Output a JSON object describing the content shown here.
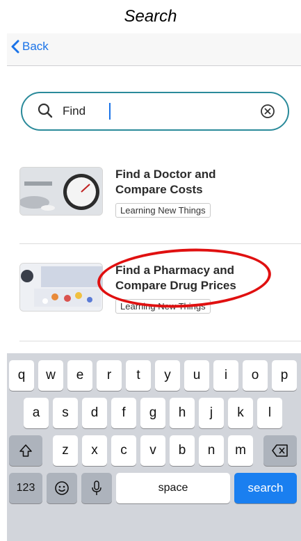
{
  "caption": "Search",
  "nav": {
    "back_label": "Back"
  },
  "search": {
    "value": "Find"
  },
  "results": [
    {
      "title_line1": "Find a Doctor and",
      "title_line2": "Compare Costs",
      "tag": "Learning New Things"
    },
    {
      "title_line1": "Find a Pharmacy and",
      "title_line2": "Compare Drug Prices",
      "tag": "Learning New Things"
    }
  ],
  "keyboard": {
    "row1": [
      "q",
      "w",
      "e",
      "r",
      "t",
      "y",
      "u",
      "i",
      "o",
      "p"
    ],
    "row2": [
      "a",
      "s",
      "d",
      "f",
      "g",
      "h",
      "j",
      "k",
      "l"
    ],
    "row3": [
      "z",
      "x",
      "c",
      "v",
      "b",
      "n",
      "m"
    ],
    "numbers_key": "123",
    "space_key": "space",
    "search_key": "search"
  },
  "colors": {
    "accent": "#1a73e8",
    "search_border": "#2a8a9a",
    "annotation": "#e01010"
  }
}
